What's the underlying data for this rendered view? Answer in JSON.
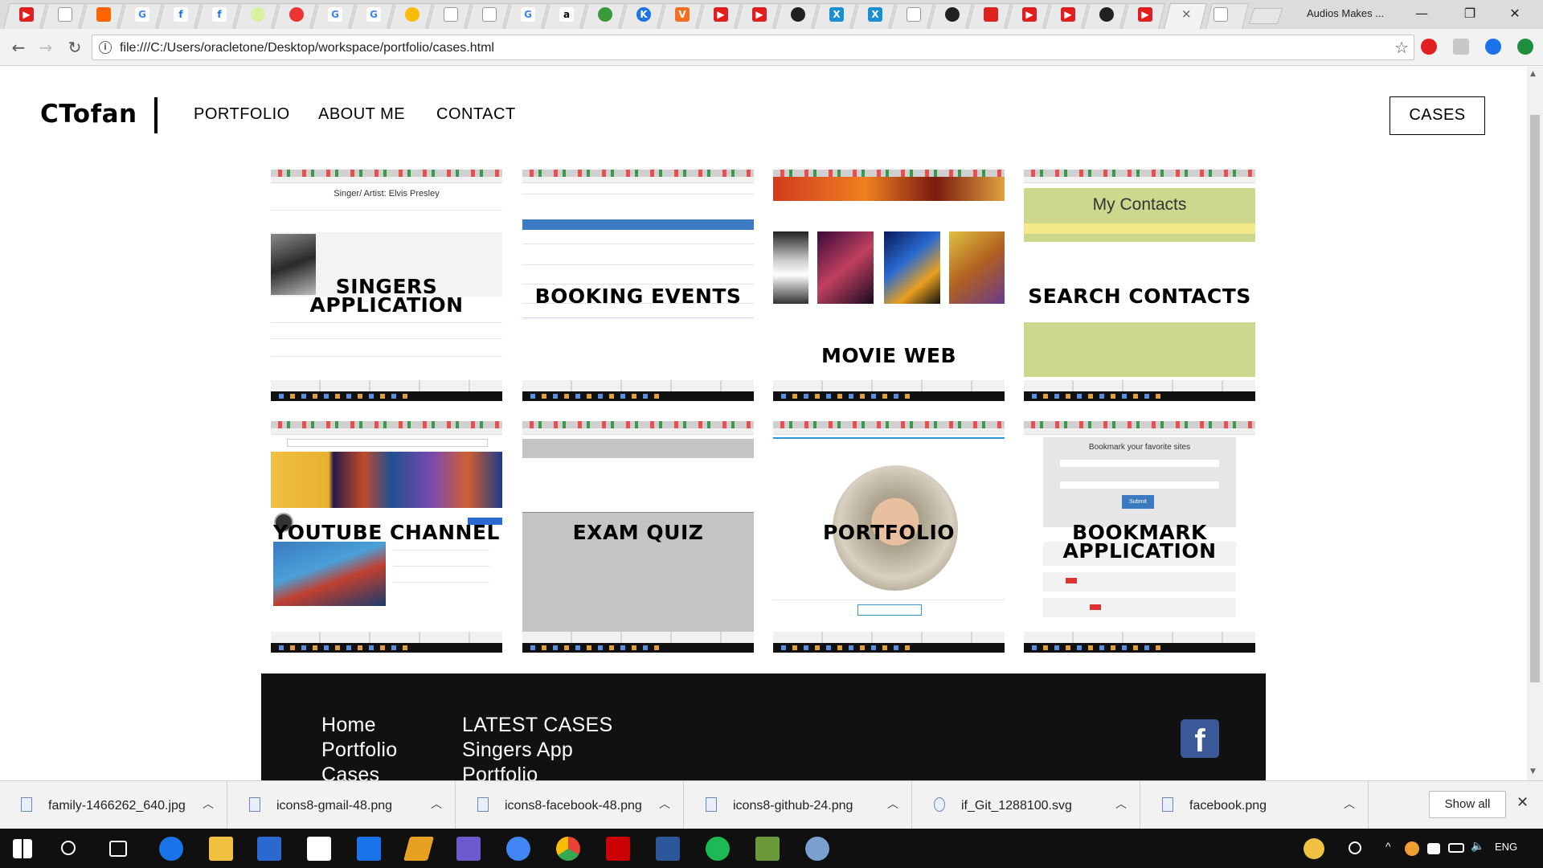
{
  "browser": {
    "profile_name": "Audios Makes ...",
    "url": "file:///C:/Users/oracletone/Desktop/workspace/portfolio/cases.html",
    "tab_close": "×",
    "window_controls": {
      "minimize": "—",
      "restore": "❐",
      "close": "✕"
    }
  },
  "site": {
    "logo": "CTofan",
    "nav": {
      "portfolio": "PORTFOLIO",
      "about": "ABOUT ME",
      "contact": "CONTACT"
    },
    "cases_button": "CASES"
  },
  "cards": [
    {
      "title_line1": "SINGERS",
      "title_line2": "APPLICATION",
      "caption": "Singer/ Artist: Elvis Presley"
    },
    {
      "title_line1": "BOOKING EVENTS"
    },
    {
      "title_line1": "MOVIE WEB"
    },
    {
      "title_line1": "SEARCH CONTACTS",
      "caption": "My Contacts"
    },
    {
      "title_line1": "YOUTUBE CHANNEL"
    },
    {
      "title_line1": "EXAM QUIZ"
    },
    {
      "title_line1": "PORTFOLIO"
    },
    {
      "title_line1": "BOOKMARK",
      "title_line2": "APPLICATION",
      "caption": "Bookmark your favorite sites",
      "submit": "Submit"
    }
  ],
  "footer": {
    "links": [
      "Home",
      "Portfolio",
      "Cases"
    ],
    "latest_heading": "LATEST CASES",
    "latest": [
      "Singers App",
      "Portfolio"
    ],
    "facebook_letter": "f"
  },
  "downloads": {
    "files": [
      "family-1466262_640.jpg",
      "icons8-gmail-48.png",
      "icons8-facebook-48.png",
      "icons8-github-24.png",
      "if_Git_1288100.svg",
      "facebook.png"
    ],
    "show_all": "Show all"
  },
  "taskbar": {
    "language": "ENG"
  },
  "colors": {
    "facebook": "#3b5998",
    "booking_bar": "#3d7cc4",
    "contacts_green": "#cdd88e",
    "contacts_yellow": "#f4e98a"
  }
}
